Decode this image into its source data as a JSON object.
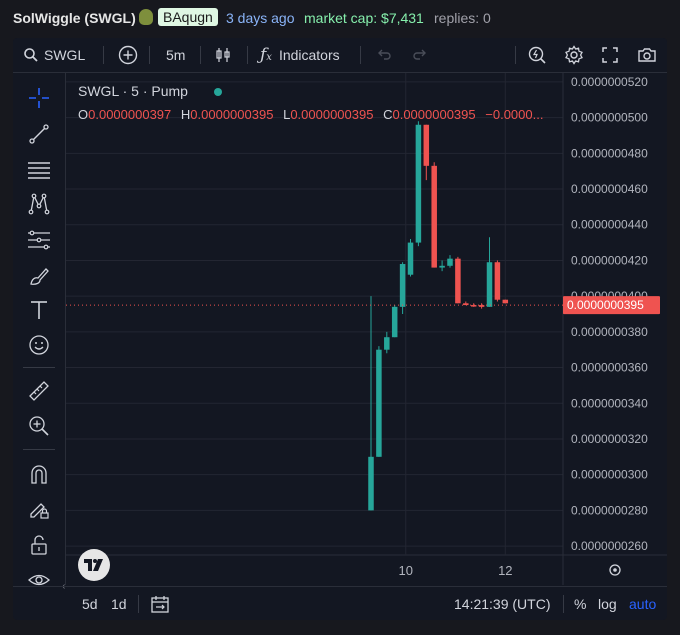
{
  "header": {
    "title": "SolWiggle (SWGL)",
    "creator": "BAqugn",
    "age": "3 days ago",
    "market_cap": "market cap: $7,431",
    "replies": "replies: 0"
  },
  "toolbar": {
    "symbol": "SWGL",
    "interval": "5m",
    "indicators": "Indicators"
  },
  "left_tools": [
    "crosshair-icon",
    "trend-line-icon",
    "horizontal-lines-icon",
    "pattern-icon",
    "fib-icon",
    "brush-icon",
    "text-icon",
    "emoji-icon",
    "ruler-icon",
    "zoom-in-icon",
    "magnet-icon",
    "lock-drawing-icon",
    "unlock-icon",
    "eye-icon"
  ],
  "legend": {
    "title": "SWGL · 5 · Pump",
    "o_label": "O",
    "o": "0.0000000397",
    "h_label": "H",
    "h": "0.0000000395",
    "l_label": "L",
    "l": "0.0000000395",
    "c_label": "C",
    "c": "0.0000000395",
    "change": "−0.0000..."
  },
  "price_axis": {
    "ticks": [
      "0.0000000520",
      "0.0000000500",
      "0.0000000480",
      "0.0000000460",
      "0.0000000440",
      "0.0000000420",
      "0.0000000400",
      "0.0000000380",
      "0.0000000360",
      "0.0000000340",
      "0.0000000320",
      "0.0000000300",
      "0.0000000280",
      "0.0000000260"
    ],
    "last_price_label": "0.0000000395"
  },
  "time_axis": {
    "ticks": [
      "10",
      "12"
    ]
  },
  "bottom": {
    "range_5d": "5d",
    "range_1d": "1d",
    "clock": "14:21:39 (UTC)",
    "percent": "%",
    "log": "log",
    "auto": "auto"
  },
  "chart_data": {
    "type": "candlestick",
    "symbol": "SWGL",
    "interval": "5",
    "y_range": [
      2.55e-08,
      5.25e-08
    ],
    "last_price": 3.95e-08,
    "candles": [
      {
        "t": 0,
        "o": 2.8e-08,
        "h": 4e-08,
        "l": 2.8e-08,
        "c": 3.1e-08,
        "dir": "up"
      },
      {
        "t": 1,
        "o": 3.1e-08,
        "h": 3.72e-08,
        "l": 3.1e-08,
        "c": 3.7e-08,
        "dir": "up"
      },
      {
        "t": 2,
        "o": 3.7e-08,
        "h": 3.8e-08,
        "l": 3.68e-08,
        "c": 3.77e-08,
        "dir": "up"
      },
      {
        "t": 3,
        "o": 3.77e-08,
        "h": 3.95e-08,
        "l": 3.77e-08,
        "c": 3.94e-08,
        "dir": "up"
      },
      {
        "t": 4,
        "o": 3.94e-08,
        "h": 4.19e-08,
        "l": 3.9e-08,
        "c": 4.18e-08,
        "dir": "up"
      },
      {
        "t": 5,
        "o": 4.12e-08,
        "h": 4.32e-08,
        "l": 4.11e-08,
        "c": 4.3e-08,
        "dir": "up"
      },
      {
        "t": 6,
        "o": 4.3e-08,
        "h": 4.98e-08,
        "l": 4.28e-08,
        "c": 4.96e-08,
        "dir": "up"
      },
      {
        "t": 7,
        "o": 4.96e-08,
        "h": 4.96e-08,
        "l": 4.65e-08,
        "c": 4.73e-08,
        "dir": "down"
      },
      {
        "t": 8,
        "o": 4.73e-08,
        "h": 4.75e-08,
        "l": 4.16e-08,
        "c": 4.16e-08,
        "dir": "down"
      },
      {
        "t": 9,
        "o": 4.16e-08,
        "h": 4.2e-08,
        "l": 4.14e-08,
        "c": 4.17e-08,
        "dir": "up"
      },
      {
        "t": 10,
        "o": 4.17e-08,
        "h": 4.23e-08,
        "l": 4.16e-08,
        "c": 4.21e-08,
        "dir": "up"
      },
      {
        "t": 11,
        "o": 4.21e-08,
        "h": 4.22e-08,
        "l": 3.96e-08,
        "c": 3.96e-08,
        "dir": "down"
      },
      {
        "t": 12,
        "o": 3.96e-08,
        "h": 3.97e-08,
        "l": 3.95e-08,
        "c": 3.95e-08,
        "dir": "down"
      },
      {
        "t": 13,
        "o": 3.95e-08,
        "h": 3.96e-08,
        "l": 3.94e-08,
        "c": 3.95e-08,
        "dir": "down"
      },
      {
        "t": 14,
        "o": 3.95e-08,
        "h": 3.96e-08,
        "l": 3.93e-08,
        "c": 3.94e-08,
        "dir": "down"
      },
      {
        "t": 15,
        "o": 3.94e-08,
        "h": 4.33e-08,
        "l": 3.94e-08,
        "c": 4.19e-08,
        "dir": "up"
      },
      {
        "t": 16,
        "o": 4.19e-08,
        "h": 4.2e-08,
        "l": 3.97e-08,
        "c": 3.98e-08,
        "dir": "down"
      },
      {
        "t": 17,
        "o": 3.98e-08,
        "h": 3.98e-08,
        "l": 3.96e-08,
        "c": 3.96e-08,
        "dir": "down"
      }
    ],
    "colors": {
      "up": "#26a69a",
      "down": "#ef5350",
      "background": "#131722",
      "grid": "#232632"
    }
  }
}
